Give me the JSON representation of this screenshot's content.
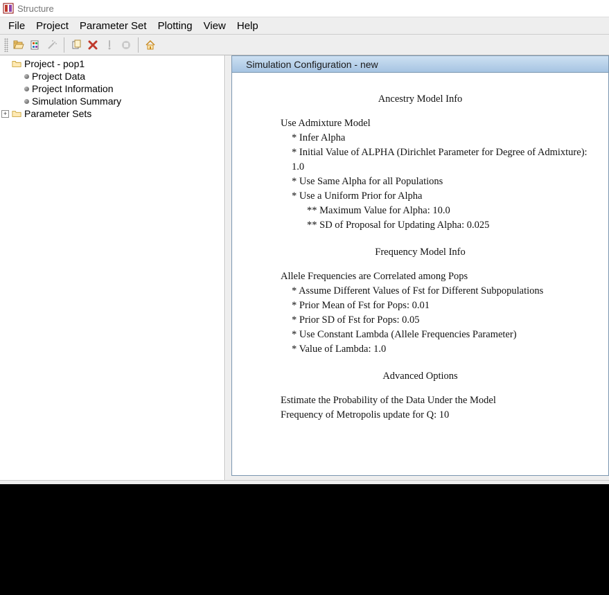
{
  "window": {
    "title": "Structure"
  },
  "menu": {
    "items": [
      "File",
      "Project",
      "Parameter Set",
      "Plotting",
      "View",
      "Help"
    ]
  },
  "tree": {
    "root": {
      "label": "Project - pop1"
    },
    "children": [
      {
        "label": "Project Data"
      },
      {
        "label": "Project Information"
      },
      {
        "label": "Simulation Summary"
      }
    ],
    "paramsets": {
      "label": "Parameter Sets"
    }
  },
  "panel": {
    "title": "Simulation Configuration - new",
    "sections": {
      "ancestry": {
        "title": "Ancestry Model Info",
        "root": "Use Admixture Model",
        "lines": {
          "infer_alpha": "* Infer Alpha",
          "initial_alpha": "* Initial Value of ALPHA (Dirichlet Parameter for Degree of Admixture):  1.0",
          "same_alpha": "* Use Same Alpha for all Populations",
          "uniform_prior": "* Use a Uniform Prior for Alpha",
          "max_alpha": "** Maximum Value for Alpha: 10.0",
          "sd_proposal": "** SD of Proposal for Updating Alpha: 0.025"
        }
      },
      "frequency": {
        "title": "Frequency Model Info",
        "root": "Allele Frequencies are Correlated among Pops",
        "lines": {
          "assume_fst": "* Assume Different Values of Fst for Different Subpopulations",
          "prior_mean": "* Prior Mean of Fst for Pops: 0.01",
          "prior_sd": "* Prior SD   of Fst for Pops: 0.05",
          "const_lambda": "* Use Constant Lambda (Allele Frequencies Parameter)",
          "lambda_val": "* Value of Lambda: 1.0"
        }
      },
      "advanced": {
        "title": "Advanced Options",
        "lines": {
          "estimate_prob": "Estimate the Probability of the Data Under the Model",
          "metropolis_q": "Frequency of Metropolis update for Q: 10"
        }
      }
    }
  }
}
